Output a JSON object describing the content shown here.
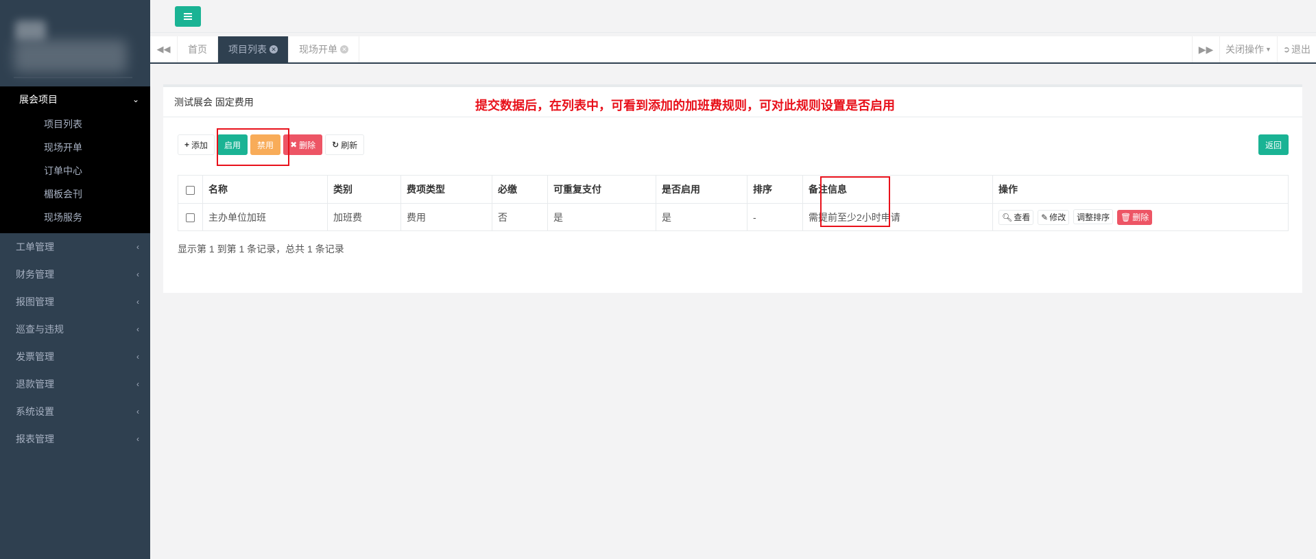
{
  "sidebar": {
    "active_group": {
      "label": "展会项目",
      "chevron": "chevron-down-icon"
    },
    "sub_items": [
      {
        "label": "项目列表"
      },
      {
        "label": "现场开单"
      },
      {
        "label": "订单中心"
      },
      {
        "label": "楣板会刊"
      },
      {
        "label": "现场服务"
      }
    ],
    "items": [
      {
        "label": "工单管理"
      },
      {
        "label": "财务管理"
      },
      {
        "label": "报图管理"
      },
      {
        "label": "巡查与违规"
      },
      {
        "label": "发票管理"
      },
      {
        "label": "退款管理"
      },
      {
        "label": "系统设置"
      },
      {
        "label": "报表管理"
      }
    ]
  },
  "tabs": {
    "items": [
      {
        "label": "首页"
      },
      {
        "label": "项目列表"
      },
      {
        "label": "现场开单"
      }
    ],
    "close_ops": "关闭操作",
    "logout": "退出"
  },
  "panel": {
    "title": "测试展会 固定费用",
    "annotation": "提交数据后，在列表中，可看到添加的加班费规则，可对此规则设置是否启用"
  },
  "toolbar": {
    "add": "添加",
    "enable": "启用",
    "disable": "禁用",
    "delete": "删除",
    "refresh": "刷新",
    "back": "返回"
  },
  "table": {
    "headers": [
      "名称",
      "类别",
      "费项类型",
      "必缴",
      "可重复支付",
      "是否启用",
      "排序",
      "备注信息",
      "操作"
    ],
    "rows": [
      {
        "name": "主办单位加班",
        "category": "加班费",
        "fee_type": "费用",
        "required": "否",
        "repeatable": "是",
        "enabled": "是",
        "sort": "-",
        "remark": "需提前至少2小时申请",
        "ops": {
          "view": "查看",
          "edit": "修改",
          "reorder": "调整排序",
          "delete": "删除"
        }
      }
    ]
  },
  "pager": {
    "summary": "显示第 1 到第 1 条记录，总共 1 条记录"
  },
  "colors": {
    "sidebar": "#2f4050",
    "primary": "#1ab394",
    "warning": "#f8ac59",
    "danger": "#ed5565",
    "annotation": "#e8101a"
  }
}
